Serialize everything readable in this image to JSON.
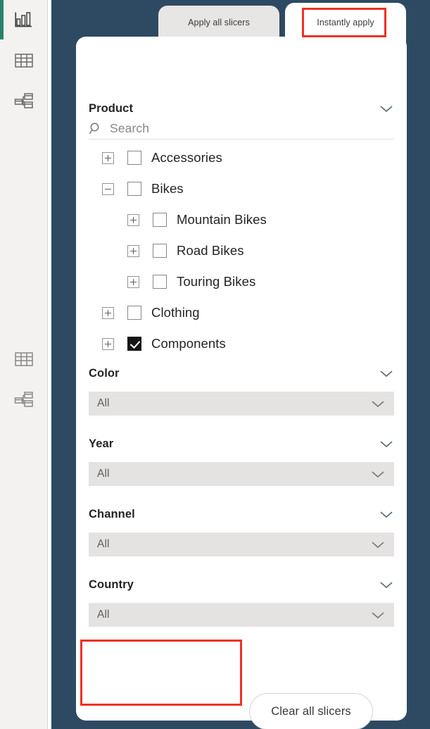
{
  "colors": {
    "canvas": "#2e4a63",
    "sidebar": "#f3f2f1",
    "card": "#ffffff",
    "accent_green": "#28826a",
    "annotation_red": "#ef3124",
    "dropdown_fill": "#e4e3e2",
    "tab_inactive": "#e8e6e4",
    "tab_active": "#ffffff",
    "text_primary": "#252423",
    "text_muted": "#8a8886"
  },
  "sidebar": {
    "items": [
      {
        "name": "report-view",
        "icon": "report-bar-chart-icon",
        "selected": true
      },
      {
        "name": "data-view",
        "icon": "table-grid-icon",
        "selected": false
      },
      {
        "name": "model-view",
        "icon": "model-relationship-icon",
        "selected": false
      },
      {
        "name": "data-view-secondary",
        "icon": "table-grid-icon",
        "selected": false
      },
      {
        "name": "model-view-secondary",
        "icon": "model-relationship-icon",
        "selected": false
      }
    ]
  },
  "tabs": [
    {
      "label": "Apply all slicers",
      "active": false
    },
    {
      "label": "Instantly apply",
      "active": true
    }
  ],
  "slicers": {
    "product": {
      "title": "Product",
      "search_placeholder": "Search",
      "search_value": "",
      "tree": [
        {
          "label": "Accessories",
          "level": 1,
          "expander": "plus",
          "checked": false
        },
        {
          "label": "Bikes",
          "level": 1,
          "expander": "minus",
          "checked": false
        },
        {
          "label": "Mountain Bikes",
          "level": 2,
          "expander": "plus",
          "checked": false
        },
        {
          "label": "Road Bikes",
          "level": 2,
          "expander": "plus",
          "checked": false
        },
        {
          "label": "Touring Bikes",
          "level": 2,
          "expander": "plus",
          "checked": false
        },
        {
          "label": "Clothing",
          "level": 1,
          "expander": "plus",
          "checked": false
        },
        {
          "label": "Components",
          "level": 1,
          "expander": "plus",
          "checked": true
        }
      ]
    },
    "dropdowns": [
      {
        "title": "Color",
        "value": "All"
      },
      {
        "title": "Year",
        "value": "All"
      },
      {
        "title": "Channel",
        "value": "All"
      },
      {
        "title": "Country",
        "value": "All"
      }
    ]
  },
  "actions": {
    "clear_all_label": "Clear all slicers"
  },
  "annotations": [
    {
      "name": "instantly-apply-highlight",
      "target": "Instantly apply"
    },
    {
      "name": "blank-area-highlight",
      "target": ""
    }
  ]
}
